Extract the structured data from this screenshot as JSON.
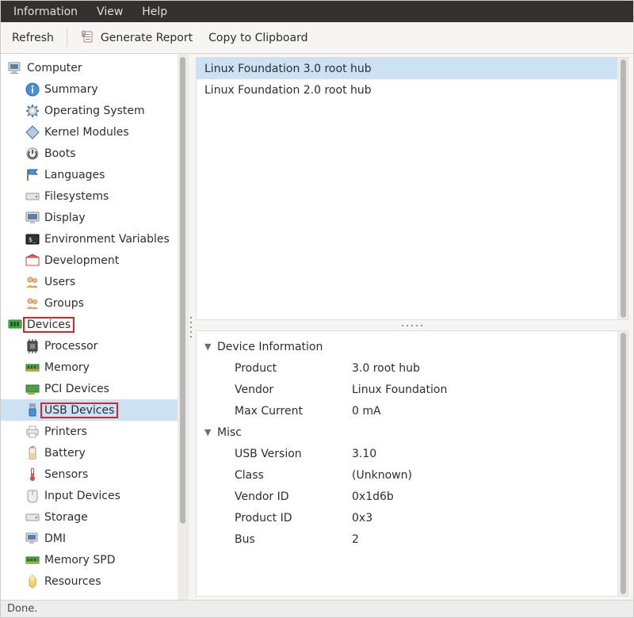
{
  "menu": {
    "information": "Information",
    "view": "View",
    "help": "Help"
  },
  "toolbar": {
    "refresh": "Refresh",
    "generate_report": "Generate Report",
    "copy": "Copy to Clipboard"
  },
  "tree": {
    "computer": {
      "label": "Computer",
      "children": [
        {
          "label": "Summary",
          "icon": "info"
        },
        {
          "label": "Operating System",
          "icon": "gear"
        },
        {
          "label": "Kernel Modules",
          "icon": "diamond"
        },
        {
          "label": "Boots",
          "icon": "power"
        },
        {
          "label": "Languages",
          "icon": "flag"
        },
        {
          "label": "Filesystems",
          "icon": "drive"
        },
        {
          "label": "Display",
          "icon": "monitor"
        },
        {
          "label": "Environment Variables",
          "icon": "terminal"
        },
        {
          "label": "Development",
          "icon": "dev"
        },
        {
          "label": "Users",
          "icon": "users"
        },
        {
          "label": "Groups",
          "icon": "users"
        }
      ]
    },
    "devices": {
      "label": "Devices",
      "children": [
        {
          "label": "Processor",
          "icon": "cpu"
        },
        {
          "label": "Memory",
          "icon": "memory"
        },
        {
          "label": "PCI Devices",
          "icon": "pci"
        },
        {
          "label": "USB Devices",
          "icon": "usb",
          "selected": true,
          "highlight": true
        },
        {
          "label": "Printers",
          "icon": "printer"
        },
        {
          "label": "Battery",
          "icon": "battery"
        },
        {
          "label": "Sensors",
          "icon": "sensor"
        },
        {
          "label": "Input Devices",
          "icon": "input"
        },
        {
          "label": "Storage",
          "icon": "drive"
        },
        {
          "label": "DMI",
          "icon": "dmi"
        },
        {
          "label": "Memory SPD",
          "icon": "memory"
        },
        {
          "label": "Resources",
          "icon": "resources"
        }
      ]
    }
  },
  "device_list": [
    {
      "label": "Linux Foundation 3.0 root hub",
      "selected": true
    },
    {
      "label": "Linux Foundation 2.0 root hub",
      "selected": false
    }
  ],
  "detail": {
    "sections": [
      {
        "title": "Device Information",
        "rows": [
          {
            "k": "Product",
            "v": "3.0 root hub"
          },
          {
            "k": "Vendor",
            "v": "Linux Foundation"
          },
          {
            "k": "Max Current",
            "v": "0 mA"
          }
        ]
      },
      {
        "title": "Misc",
        "rows": [
          {
            "k": "USB Version",
            "v": "3.10"
          },
          {
            "k": "Class",
            "v": "(Unknown)"
          },
          {
            "k": "Vendor ID",
            "v": "0x1d6b"
          },
          {
            "k": "Product ID",
            "v": "0x3"
          },
          {
            "k": "Bus",
            "v": "2"
          }
        ]
      }
    ]
  },
  "status": "Done."
}
